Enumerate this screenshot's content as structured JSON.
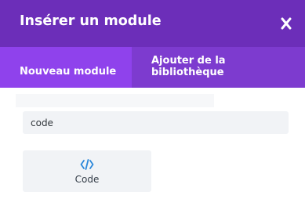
{
  "dialog": {
    "title": "Insérer un module",
    "close_icon": "close-icon"
  },
  "tabs": [
    {
      "label": "Nouveau module",
      "active": true
    },
    {
      "label": "Ajouter de la bibliothèque",
      "active": false
    }
  ],
  "search": {
    "value": "code",
    "placeholder": ""
  },
  "modules": [
    {
      "label": "Code",
      "icon": "code-icon"
    }
  ],
  "colors": {
    "header": "#6c2eb9",
    "tab_bar": "#7d3bcf",
    "tab_active": "#8f42ec",
    "icon_accent": "#2b87da"
  }
}
